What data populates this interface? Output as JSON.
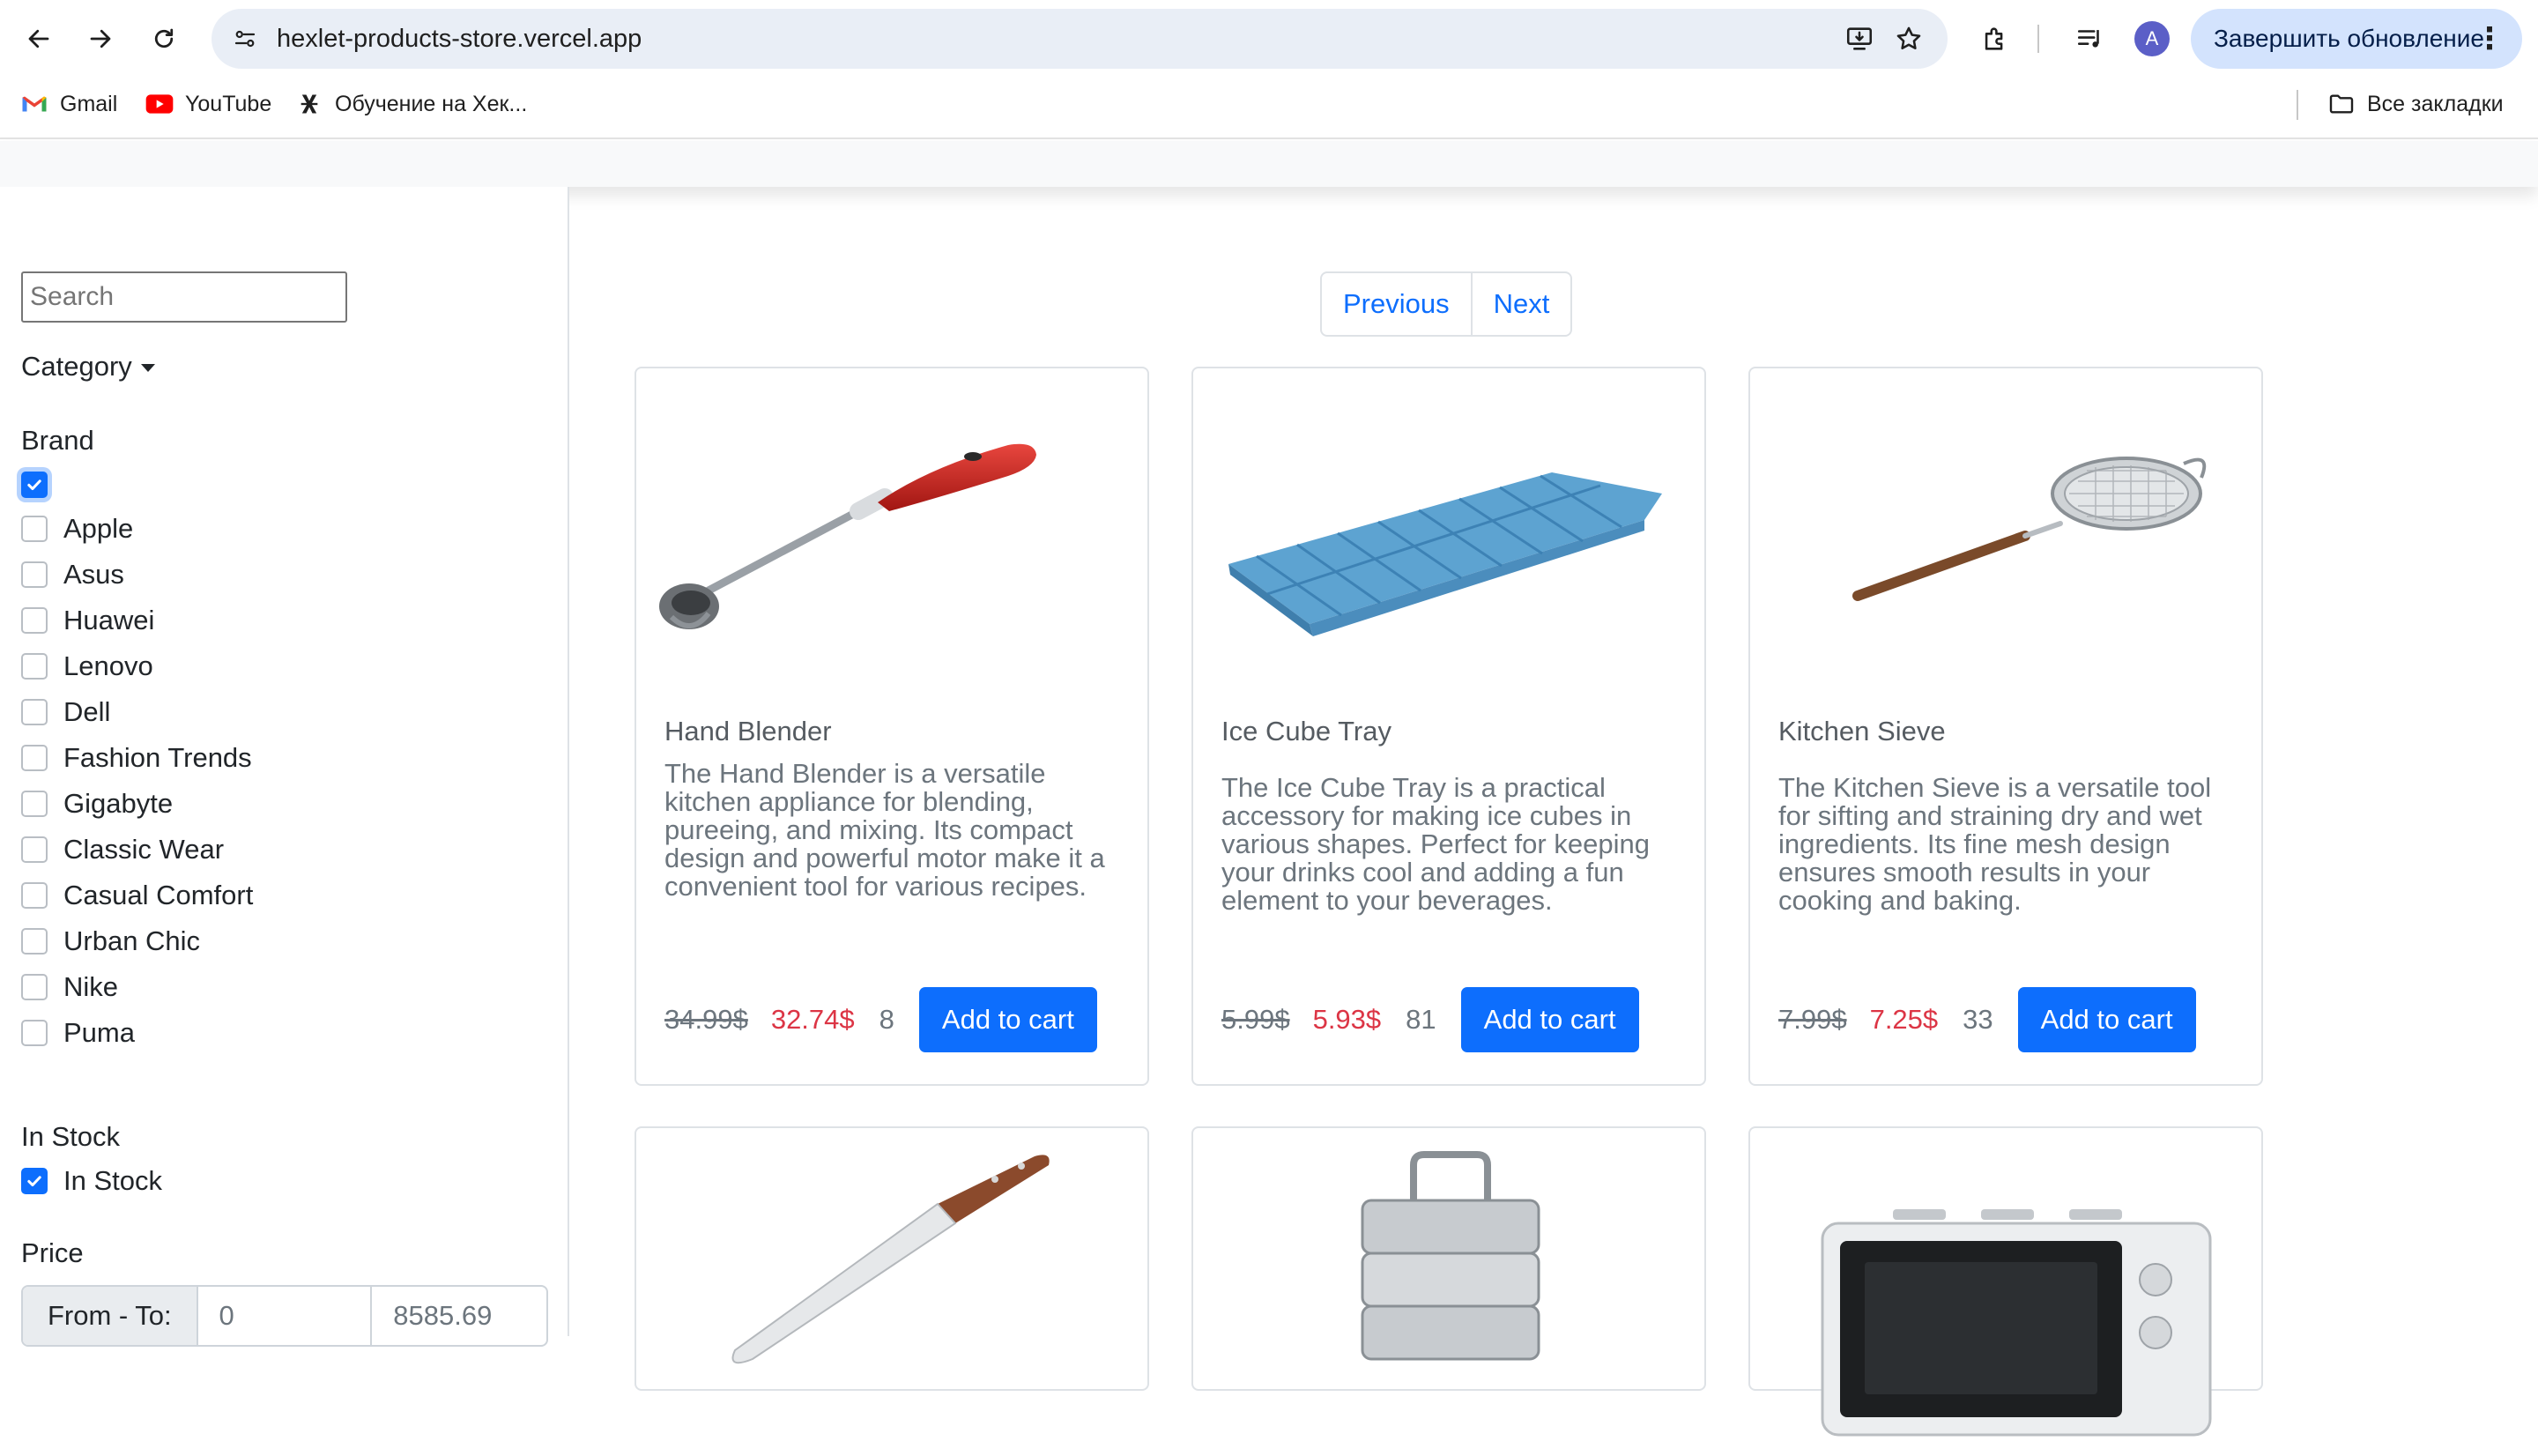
{
  "browser": {
    "url": "hexlet-products-store.vercel.app",
    "update_button": "Завершить обновление",
    "avatar_letter": "A",
    "bookmarks": [
      "Gmail",
      "YouTube",
      "Обучение на Хек..."
    ],
    "all_bookmarks": "Все закладки"
  },
  "filters": {
    "search_placeholder": "Search",
    "category_label": "Category",
    "brand_title": "Brand",
    "brands": [
      "Apple",
      "Asus",
      "Huawei",
      "Lenovo",
      "Dell",
      "Fashion Trends",
      "Gigabyte",
      "Classic Wear",
      "Casual Comfort",
      "Urban Chic",
      "Nike",
      "Puma"
    ],
    "brand_all_checked": true,
    "in_stock_title": "In Stock",
    "in_stock_label": "In Stock",
    "in_stock_checked": true,
    "price_title": "Price",
    "price_addon": "From - To:",
    "price_from": "0",
    "price_to": "8585.69"
  },
  "pagination": {
    "previous": "Previous",
    "next": "Next"
  },
  "products": [
    {
      "title": "Hand Blender",
      "description": "The Hand Blender is a versatile kitchen appliance for blending, pureeing, and mixing. Its compact design and powerful motor make it a convenient tool for various recipes.",
      "old_price": "34.99$",
      "new_price": "32.74$",
      "stock": "8",
      "button": "Add to cart",
      "image": "hand-blender"
    },
    {
      "title": "Ice Cube Tray",
      "description": "The Ice Cube Tray is a practical accessory for making ice cubes in various shapes. Perfect for keeping your drinks cool and adding a fun element to your beverages.",
      "old_price": "5.99$",
      "new_price": "5.93$",
      "stock": "81",
      "button": "Add to cart",
      "image": "ice-cube-tray"
    },
    {
      "title": "Kitchen Sieve",
      "description": "The Kitchen Sieve is a versatile tool for sifting and straining dry and wet ingredients. Its fine mesh design ensures smooth results in your cooking and baking.",
      "old_price": "7.99$",
      "new_price": "7.25$",
      "stock": "33",
      "button": "Add to cart",
      "image": "kitchen-sieve"
    },
    {
      "image": "knife"
    },
    {
      "image": "lunch-box"
    },
    {
      "image": "microwave"
    }
  ]
}
